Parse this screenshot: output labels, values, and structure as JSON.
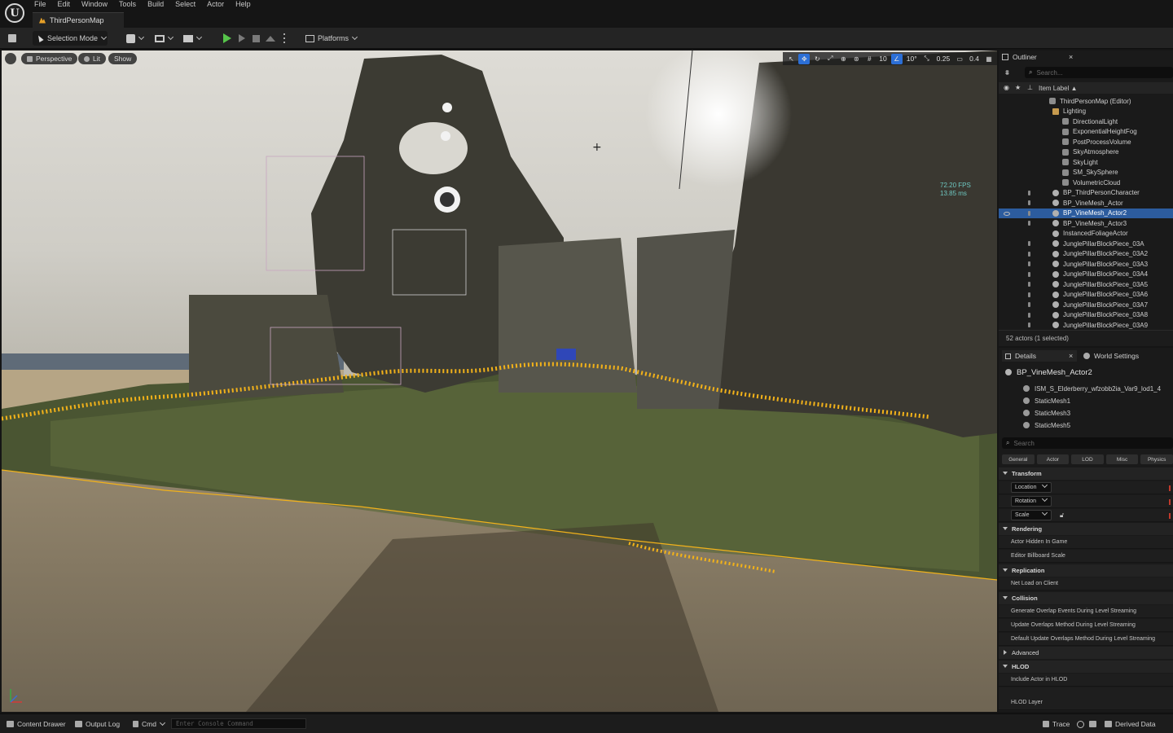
{
  "menu": {
    "items": [
      "File",
      "Edit",
      "Window",
      "Tools",
      "Build",
      "Select",
      "Actor",
      "Help"
    ],
    "map_tab": "ThirdPersonMap"
  },
  "toolbar": {
    "selection_mode": "Selection Mode",
    "platforms": "Platforms"
  },
  "viewport": {
    "perspective": "Perspective",
    "lit": "Lit",
    "show": "Show",
    "grid_snap": "10",
    "rotation_snap": "10°",
    "scale_snap": "0.25",
    "camera_speed": "0.4",
    "fps": "72.20 FPS",
    "ms": "13.85 ms"
  },
  "outliner": {
    "tab_label": "Outliner",
    "search_placeholder": "Search...",
    "column_label": "Item Label ▲",
    "rows": [
      {
        "label": "ThirdPersonMap (Editor)",
        "indent": 0,
        "type": "map"
      },
      {
        "label": "Lighting",
        "indent": 1,
        "type": "folder"
      },
      {
        "label": "DirectionalLight",
        "indent": 2,
        "type": "light"
      },
      {
        "label": "ExponentialHeightFog",
        "indent": 2,
        "type": "light"
      },
      {
        "label": "PostProcessVolume",
        "indent": 2,
        "type": "light"
      },
      {
        "label": "SkyAtmosphere",
        "indent": 2,
        "type": "light"
      },
      {
        "label": "SkyLight",
        "indent": 2,
        "type": "light"
      },
      {
        "label": "SM_SkySphere",
        "indent": 2,
        "type": "light"
      },
      {
        "label": "VolumetricCloud",
        "indent": 2,
        "type": "light"
      },
      {
        "label": "BP_ThirdPersonCharacter",
        "indent": 1,
        "type": "actor"
      },
      {
        "label": "BP_VineMesh_Actor",
        "indent": 1,
        "type": "actor"
      },
      {
        "label": "BP_VineMesh_Actor2",
        "indent": 1,
        "type": "actor",
        "selected": true
      },
      {
        "label": "BP_VineMesh_Actor3",
        "indent": 1,
        "type": "actor"
      },
      {
        "label": "InstancedFoliageActor",
        "indent": 1,
        "type": "actor"
      },
      {
        "label": "JunglePillarBlockPiece_03A",
        "indent": 1,
        "type": "actor"
      },
      {
        "label": "JunglePillarBlockPiece_03A2",
        "indent": 1,
        "type": "actor"
      },
      {
        "label": "JunglePillarBlockPiece_03A3",
        "indent": 1,
        "type": "actor"
      },
      {
        "label": "JunglePillarBlockPiece_03A4",
        "indent": 1,
        "type": "actor"
      },
      {
        "label": "JunglePillarBlockPiece_03A5",
        "indent": 1,
        "type": "actor"
      },
      {
        "label": "JunglePillarBlockPiece_03A6",
        "indent": 1,
        "type": "actor"
      },
      {
        "label": "JunglePillarBlockPiece_03A7",
        "indent": 1,
        "type": "actor"
      },
      {
        "label": "JunglePillarBlockPiece_03A8",
        "indent": 1,
        "type": "actor"
      },
      {
        "label": "JunglePillarBlockPiece_03A9",
        "indent": 1,
        "type": "actor"
      }
    ],
    "footer": "52 actors (1 selected)"
  },
  "details": {
    "tab_label": "Details",
    "world_settings_label": "World Settings",
    "actor_name": "BP_VineMesh_Actor2",
    "components": [
      "ISM_S_Elderberry_wfzobb2ia_Var9_lod1_4",
      "StaticMesh1",
      "StaticMesh3",
      "StaticMesh5"
    ],
    "search_placeholder": "Search",
    "filter_tabs": [
      "General",
      "Actor",
      "LOD",
      "Misc",
      "Physics"
    ],
    "transform_section": "Transform",
    "location": "Location",
    "rotation": "Rotation",
    "scale": "Scale",
    "rendering_section": "Rendering",
    "actor_hidden": "Actor Hidden In Game",
    "billboard_scale": "Editor Billboard Scale",
    "replication_section": "Replication",
    "net_load": "Net Load on Client",
    "collision_section": "Collision",
    "gen_overlap": "Generate Overlap Events During Level Streaming",
    "update_overlap": "Update Overlaps Method During Level Streaming",
    "default_overlap": "Default Update Overlaps Method During Level Streaming",
    "advanced_section": "Advanced",
    "hlod_section": "HLOD",
    "include_hlod": "Include Actor in HLOD",
    "hlod_layer": "HLOD Layer"
  },
  "statusbar": {
    "content_drawer": "Content Drawer",
    "output_log": "Output Log",
    "cmd": "Cmd",
    "console_placeholder": "Enter Console Command",
    "trace": "Trace",
    "derived_data": "Derived Data"
  },
  "colors": {
    "accent_blue": "#2c6fd6",
    "selection_blue": "#2c5c9e",
    "play_green": "#56c44a",
    "highlight_orange": "#f2b21a",
    "stats_cyan": "#6ec7c0"
  }
}
